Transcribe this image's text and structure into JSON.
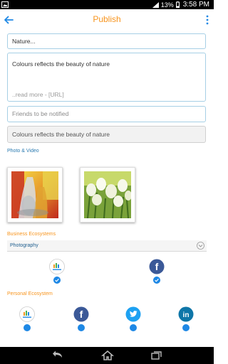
{
  "status_bar": {
    "battery": "13%",
    "time": "3:58 PM"
  },
  "header": {
    "title": "Publish"
  },
  "form": {
    "title_value": "Nature...",
    "description_value": "Colours reflects the beauty of nature",
    "read_more_placeholder": "..read more - [URL]",
    "friends_placeholder": "Friends to be notified",
    "caption_value": "Colours reflects the beauty of nature"
  },
  "media": {
    "section_label": "Photo & Video"
  },
  "business": {
    "section_label": "Business Ecosystems",
    "selected": "Photography"
  },
  "personal": {
    "section_label": "Personal Ecosystem"
  },
  "colors": {
    "accent": "#f7941d",
    "link": "#2a7ab0",
    "selected": "#1e88e5",
    "facebook": "#3b5998",
    "twitter": "#1da1f2",
    "linkedin": "#0e76a8"
  }
}
